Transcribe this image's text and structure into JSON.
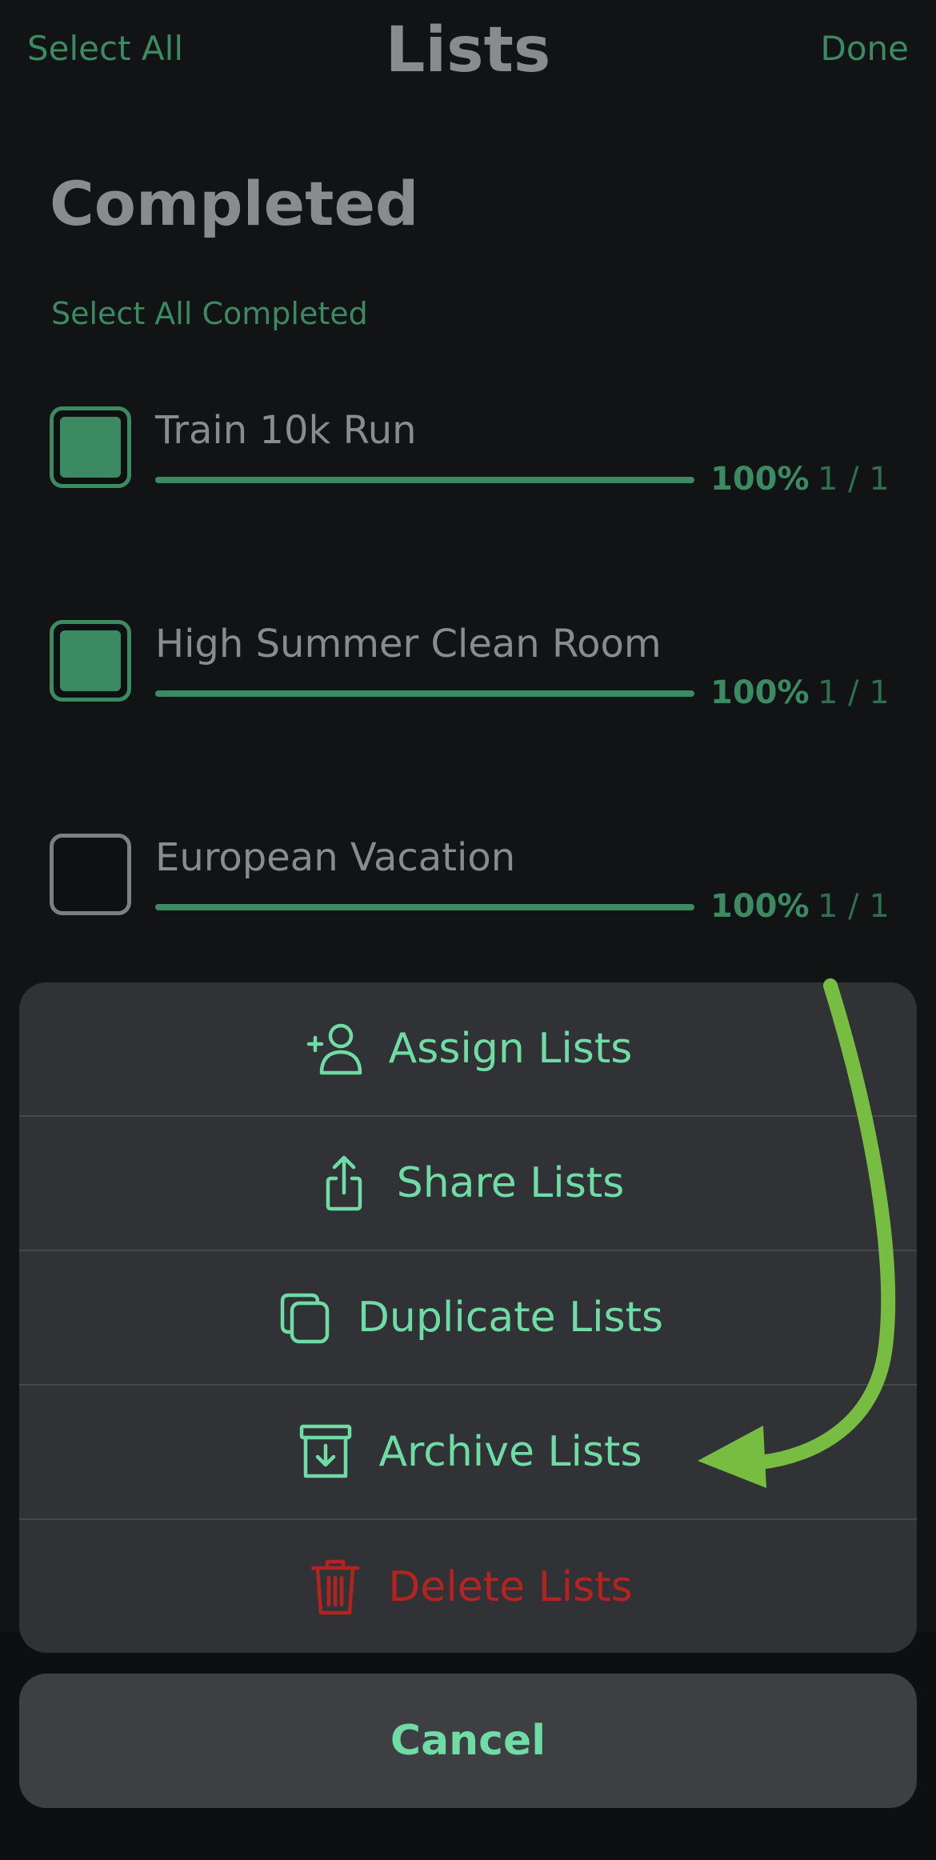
{
  "nav": {
    "select_all": "Select All",
    "title": "Lists",
    "done": "Done"
  },
  "section": {
    "title": "Completed",
    "select_all_completed": "Select All Completed"
  },
  "lists": [
    {
      "name": "Train 10k Run",
      "selected": true,
      "progress": 1.0,
      "percent": "100%",
      "count": "1 / 1"
    },
    {
      "name": "High Summer Clean Room",
      "selected": true,
      "progress": 1.0,
      "percent": "100%",
      "count": "1 / 1"
    },
    {
      "name": "European Vacation",
      "selected": false,
      "progress": 1.0,
      "percent": "100%",
      "count": "1 / 1"
    }
  ],
  "actions": {
    "assign": {
      "label": "Assign Lists",
      "icon": "add-person-icon"
    },
    "share": {
      "label": "Share Lists",
      "icon": "share-icon"
    },
    "duplicate": {
      "label": "Duplicate Lists",
      "icon": "duplicate-icon"
    },
    "archive": {
      "label": "Archive Lists",
      "icon": "archive-box-icon"
    },
    "delete": {
      "label": "Delete Lists",
      "icon": "trash-icon"
    }
  },
  "cancel_label": "Cancel",
  "colors": {
    "accent": "#6fdca6",
    "accent_dark": "#3b8a62",
    "danger": "#b3231f",
    "annotation_arrow": "#77bd42"
  }
}
